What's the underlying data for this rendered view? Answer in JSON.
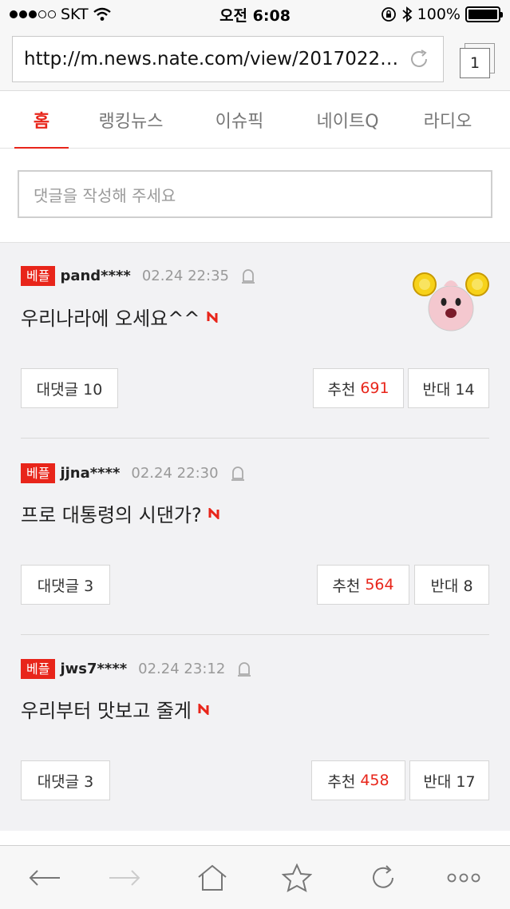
{
  "status": {
    "carrier": "SKT",
    "time": "오전 6:08",
    "battery": "100%",
    "signal_level": 3,
    "signal_max": 5,
    "battery_fraction": 1.0
  },
  "browser": {
    "url": "http://m.news.nate.com/view/2017022…",
    "tab_count": "1"
  },
  "nav": {
    "tabs": [
      "홈",
      "랭킹뉴스",
      "이슈픽",
      "네이트Q",
      "라디오"
    ],
    "active": 0
  },
  "comment_input": {
    "placeholder": "댓글을 작성해 주세요"
  },
  "comments": [
    {
      "badge": "베플",
      "user": "pand****",
      "time": "02.24 22:35",
      "text": "우리나라에 오세요^^",
      "reply_label": "대댓글 10",
      "like_label": "추천",
      "like_count": "691",
      "dislike_label": "반대 14"
    },
    {
      "badge": "베플",
      "user": "jjna****",
      "time": "02.24 22:30",
      "text": "프로 대통령의 시댄가?",
      "reply_label": "대댓글 3",
      "like_label": "추천",
      "like_count": "564",
      "dislike_label": "반대 8"
    },
    {
      "badge": "베플",
      "user": "jws7****",
      "time": "02.24 23:12",
      "text": "우리부터 맛보고 줄게",
      "reply_label": "대댓글 3",
      "like_label": "추천",
      "like_count": "458",
      "dislike_label": "반대 17"
    }
  ],
  "toolbar": {
    "icons": [
      "back-arrow-icon",
      "forward-arrow-icon",
      "home-icon",
      "star-icon",
      "refresh-icon",
      "more-icon"
    ]
  },
  "colors": {
    "accent": "#e8251a",
    "text": "#222222",
    "muted": "#999999"
  }
}
